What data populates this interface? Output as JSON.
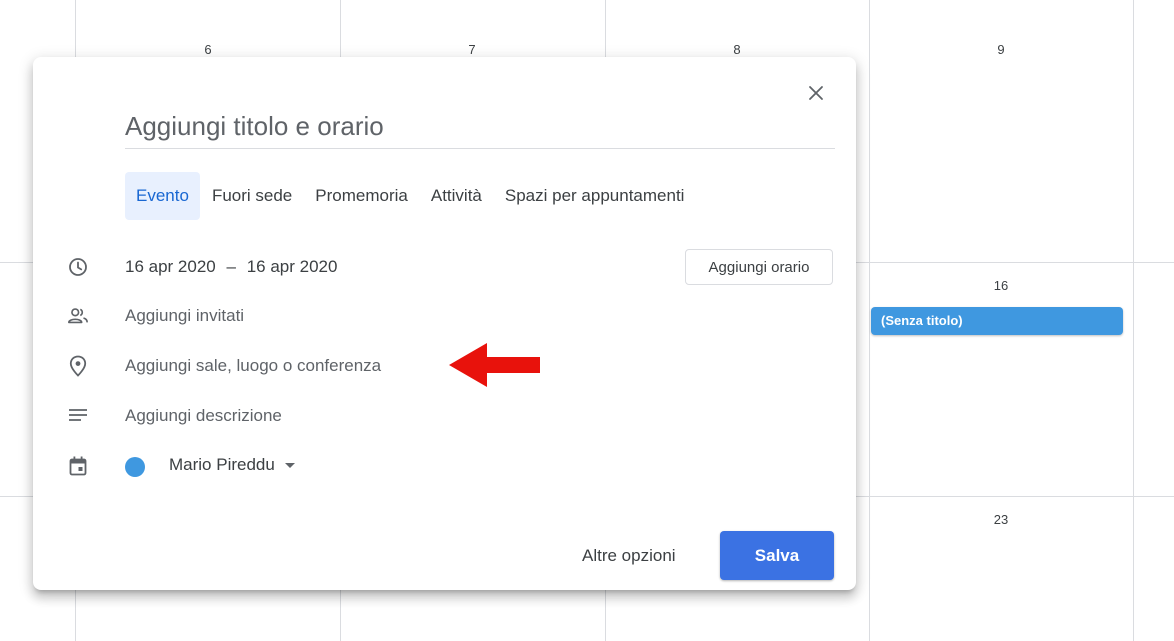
{
  "calendar": {
    "days": [
      "6",
      "7",
      "8",
      "9",
      "16",
      "23"
    ],
    "event_chip": "(Senza titolo)",
    "event_color": "#3f98e0"
  },
  "dialog": {
    "close_icon": "close-icon",
    "title_placeholder": "Aggiungi titolo e orario",
    "tabs": [
      {
        "label": "Evento",
        "active": true
      },
      {
        "label": "Fuori sede",
        "active": false
      },
      {
        "label": "Promemoria",
        "active": false
      },
      {
        "label": "Attività",
        "active": false
      },
      {
        "label": "Spazi per appuntamenti",
        "active": false
      }
    ],
    "date": {
      "icon": "clock-icon",
      "start": "16 apr 2020",
      "separator": "–",
      "end": "16 apr 2020",
      "add_time_label": "Aggiungi orario"
    },
    "guests": {
      "icon": "people-icon",
      "label": "Aggiungi invitati"
    },
    "location": {
      "icon": "location-pin-icon",
      "label": "Aggiungi sale, luogo o conferenza"
    },
    "description": {
      "icon": "notes-icon",
      "label": "Aggiungi descrizione"
    },
    "calendar_select": {
      "icon": "calendar-icon",
      "owner": "Mario Pireddu",
      "color": "#3f98e0"
    },
    "more_options_label": "Altre opzioni",
    "save_label": "Salva",
    "accent_color": "#3b72e3"
  },
  "annotation": {
    "icon": "red-arrow-icon",
    "color": "#e8120c"
  }
}
